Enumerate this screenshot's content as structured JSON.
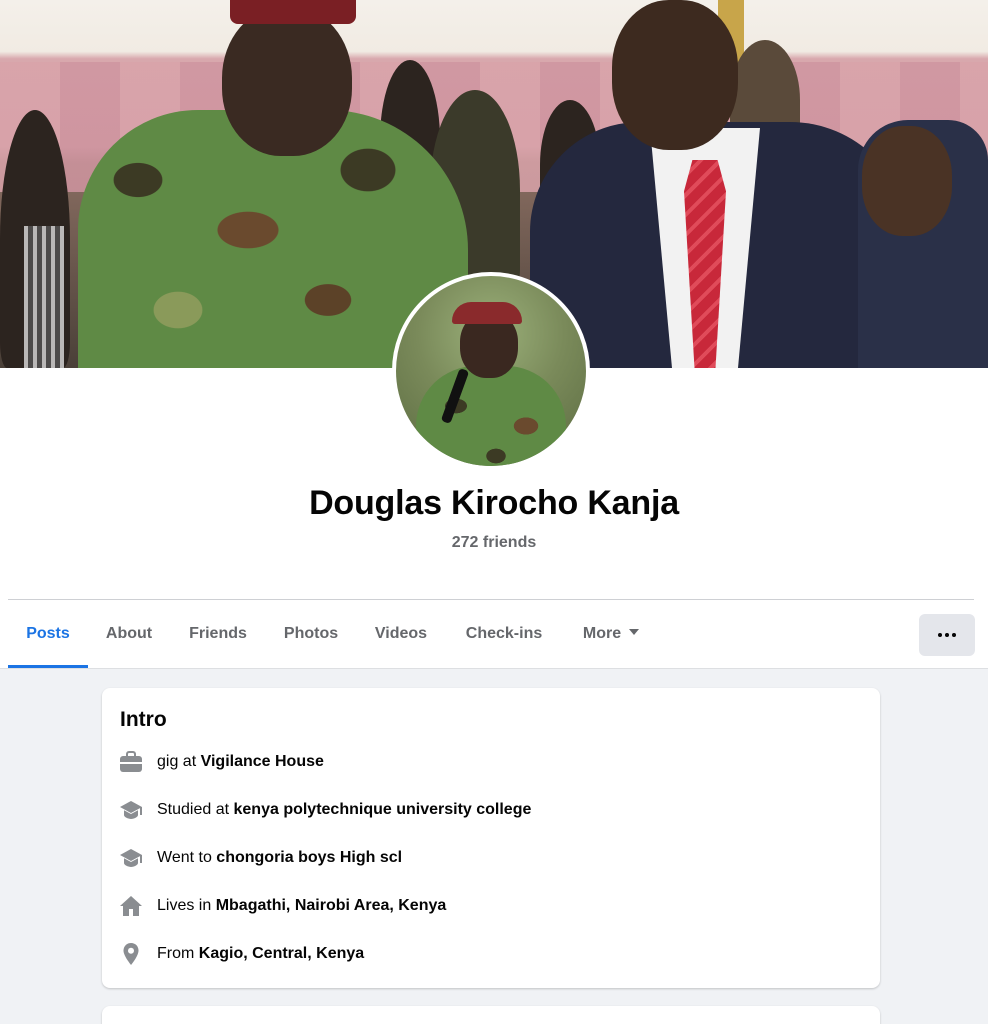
{
  "profile": {
    "name": "Douglas Kirocho Kanja",
    "friends_count": "272 friends"
  },
  "tabs": [
    {
      "label": "Posts",
      "active": true
    },
    {
      "label": "About"
    },
    {
      "label": "Friends"
    },
    {
      "label": "Photos"
    },
    {
      "label": "Videos"
    },
    {
      "label": "Check-ins"
    },
    {
      "label": "More"
    }
  ],
  "more_button_icon": "ellipsis-icon",
  "intro": {
    "title": "Intro",
    "items": [
      {
        "icon": "briefcase-icon",
        "prefix": "gig at ",
        "value": "Vigilance House"
      },
      {
        "icon": "graduation-cap-icon",
        "prefix": "Studied at ",
        "value": "kenya polytechnique university college"
      },
      {
        "icon": "graduation-cap-icon",
        "prefix": "Went to ",
        "value": "chongoria boys High scl"
      },
      {
        "icon": "home-icon",
        "prefix": "Lives in ",
        "value": "Mbagathi, Nairobi Area, Kenya"
      },
      {
        "icon": "location-pin-icon",
        "prefix": "From ",
        "value": "Kagio, Central, Kenya"
      }
    ]
  },
  "colors": {
    "accent": "#1b74e4",
    "secondary_text": "#65676b",
    "feed_background": "#f0f2f5",
    "icon_gray": "#8a8d91"
  }
}
